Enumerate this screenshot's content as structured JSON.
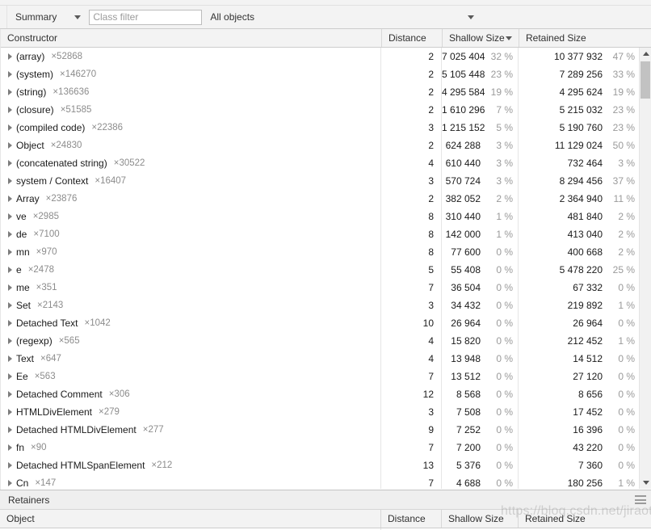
{
  "toolbar": {
    "view_select": "Summary",
    "class_filter_placeholder": "Class filter",
    "class_filter_value": "",
    "objects_select": "All objects"
  },
  "constructor_grid": {
    "columns": {
      "constructor": "Constructor",
      "distance": "Distance",
      "shallow_size": "Shallow Size",
      "retained_size": "Retained Size"
    },
    "sorted_by": "Shallow Size",
    "rows": [
      {
        "name": "(array)",
        "count": "×52868",
        "distance": "2",
        "shallow": "7 025 404",
        "shallow_pct": "32 %",
        "retained": "10 377 932",
        "retained_pct": "47 %"
      },
      {
        "name": "(system)",
        "count": "×146270",
        "distance": "2",
        "shallow": "5 105 448",
        "shallow_pct": "23 %",
        "retained": "7 289 256",
        "retained_pct": "33 %"
      },
      {
        "name": "(string)",
        "count": "×136636",
        "distance": "2",
        "shallow": "4 295 584",
        "shallow_pct": "19 %",
        "retained": "4 295 624",
        "retained_pct": "19 %"
      },
      {
        "name": "(closure)",
        "count": "×51585",
        "distance": "2",
        "shallow": "1 610 296",
        "shallow_pct": "7 %",
        "retained": "5 215 032",
        "retained_pct": "23 %"
      },
      {
        "name": "(compiled code)",
        "count": "×22386",
        "distance": "3",
        "shallow": "1 215 152",
        "shallow_pct": "5 %",
        "retained": "5 190 760",
        "retained_pct": "23 %"
      },
      {
        "name": "Object",
        "count": "×24830",
        "distance": "2",
        "shallow": "624 288",
        "shallow_pct": "3 %",
        "retained": "11 129 024",
        "retained_pct": "50 %"
      },
      {
        "name": "(concatenated string)",
        "count": "×30522",
        "distance": "4",
        "shallow": "610 440",
        "shallow_pct": "3 %",
        "retained": "732 464",
        "retained_pct": "3 %"
      },
      {
        "name": "system / Context",
        "count": "×16407",
        "distance": "3",
        "shallow": "570 724",
        "shallow_pct": "3 %",
        "retained": "8 294 456",
        "retained_pct": "37 %"
      },
      {
        "name": "Array",
        "count": "×23876",
        "distance": "2",
        "shallow": "382 052",
        "shallow_pct": "2 %",
        "retained": "2 364 940",
        "retained_pct": "11 %"
      },
      {
        "name": "ve",
        "count": "×2985",
        "distance": "8",
        "shallow": "310 440",
        "shallow_pct": "1 %",
        "retained": "481 840",
        "retained_pct": "2 %"
      },
      {
        "name": "de",
        "count": "×7100",
        "distance": "8",
        "shallow": "142 000",
        "shallow_pct": "1 %",
        "retained": "413 040",
        "retained_pct": "2 %"
      },
      {
        "name": "mn",
        "count": "×970",
        "distance": "8",
        "shallow": "77 600",
        "shallow_pct": "0 %",
        "retained": "400 668",
        "retained_pct": "2 %"
      },
      {
        "name": "e",
        "count": "×2478",
        "distance": "5",
        "shallow": "55 408",
        "shallow_pct": "0 %",
        "retained": "5 478 220",
        "retained_pct": "25 %"
      },
      {
        "name": "me",
        "count": "×351",
        "distance": "7",
        "shallow": "36 504",
        "shallow_pct": "0 %",
        "retained": "67 332",
        "retained_pct": "0 %"
      },
      {
        "name": "Set",
        "count": "×2143",
        "distance": "3",
        "shallow": "34 432",
        "shallow_pct": "0 %",
        "retained": "219 892",
        "retained_pct": "1 %"
      },
      {
        "name": "Detached Text",
        "count": "×1042",
        "distance": "10",
        "shallow": "26 964",
        "shallow_pct": "0 %",
        "retained": "26 964",
        "retained_pct": "0 %"
      },
      {
        "name": "(regexp)",
        "count": "×565",
        "distance": "4",
        "shallow": "15 820",
        "shallow_pct": "0 %",
        "retained": "212 452",
        "retained_pct": "1 %"
      },
      {
        "name": "Text",
        "count": "×647",
        "distance": "4",
        "shallow": "13 948",
        "shallow_pct": "0 %",
        "retained": "14 512",
        "retained_pct": "0 %"
      },
      {
        "name": "Ee",
        "count": "×563",
        "distance": "7",
        "shallow": "13 512",
        "shallow_pct": "0 %",
        "retained": "27 120",
        "retained_pct": "0 %"
      },
      {
        "name": "Detached Comment",
        "count": "×306",
        "distance": "12",
        "shallow": "8 568",
        "shallow_pct": "0 %",
        "retained": "8 656",
        "retained_pct": "0 %"
      },
      {
        "name": "HTMLDivElement",
        "count": "×279",
        "distance": "3",
        "shallow": "7 508",
        "shallow_pct": "0 %",
        "retained": "17 452",
        "retained_pct": "0 %"
      },
      {
        "name": "Detached HTMLDivElement",
        "count": "×277",
        "distance": "9",
        "shallow": "7 252",
        "shallow_pct": "0 %",
        "retained": "16 396",
        "retained_pct": "0 %"
      },
      {
        "name": "fn",
        "count": "×90",
        "distance": "7",
        "shallow": "7 200",
        "shallow_pct": "0 %",
        "retained": "43 220",
        "retained_pct": "0 %"
      },
      {
        "name": "Detached HTMLSpanElement",
        "count": "×212",
        "distance": "13",
        "shallow": "5 376",
        "shallow_pct": "0 %",
        "retained": "7 360",
        "retained_pct": "0 %"
      },
      {
        "name": "Cn",
        "count": "×147",
        "distance": "7",
        "shallow": "4 688",
        "shallow_pct": "0 %",
        "retained": "180 256",
        "retained_pct": "1 %"
      }
    ]
  },
  "retainers": {
    "title": "Retainers",
    "columns": {
      "object": "Object",
      "distance": "Distance",
      "shallow_size": "Shallow Size",
      "retained_size": "Retained Size"
    }
  },
  "watermark": "https://blog.csdn.net/jiraotian"
}
